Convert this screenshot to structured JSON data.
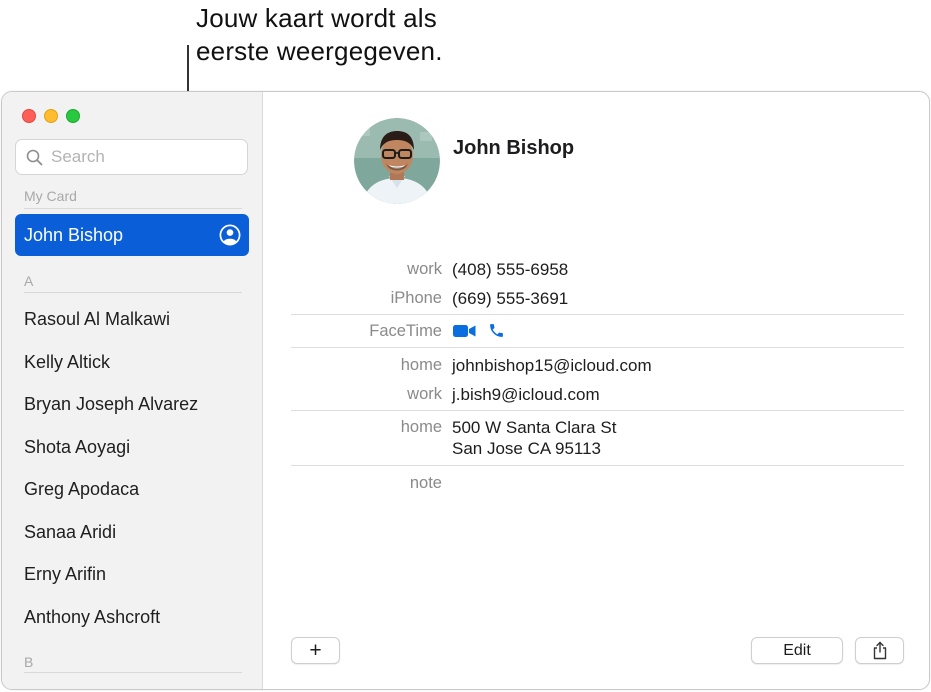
{
  "callout": {
    "line1": "Jouw kaart wordt als",
    "line2": "eerste weergegeven."
  },
  "sidebar": {
    "search_placeholder": "Search",
    "my_card_header": "My Card",
    "my_card_name": "John Bishop",
    "section_a": "A",
    "section_b": "B",
    "contacts": [
      "Rasoul Al Malkawi",
      "Kelly Altick",
      "Bryan Joseph Alvarez",
      "Shota Aoyagi",
      "Greg Apodaca",
      "Sanaa Aridi",
      "Erny Arifin",
      "Anthony Ashcroft"
    ]
  },
  "card": {
    "name": "John Bishop",
    "phones": [
      {
        "label": "work",
        "value": "(408) 555-6958"
      },
      {
        "label": "iPhone",
        "value": "(669) 555-3691"
      }
    ],
    "facetime_label": "FaceTime",
    "emails": [
      {
        "label": "home",
        "value": "johnbishop15@icloud.com"
      },
      {
        "label": "work",
        "value": "j.bish9@icloud.com"
      }
    ],
    "address": {
      "label": "home",
      "line1": "500 W Santa Clara St",
      "line2": "San Jose CA 95113"
    },
    "note_label": "note"
  },
  "toolbar": {
    "add_label": "+",
    "edit_label": "Edit"
  },
  "colors": {
    "selection": "#0a5fd8",
    "facetime": "#0a6ee0"
  },
  "icons": {
    "search": "search-icon",
    "my_card": "person-circle-icon",
    "video": "video-camera-icon",
    "phone": "phone-icon",
    "share": "share-icon"
  }
}
